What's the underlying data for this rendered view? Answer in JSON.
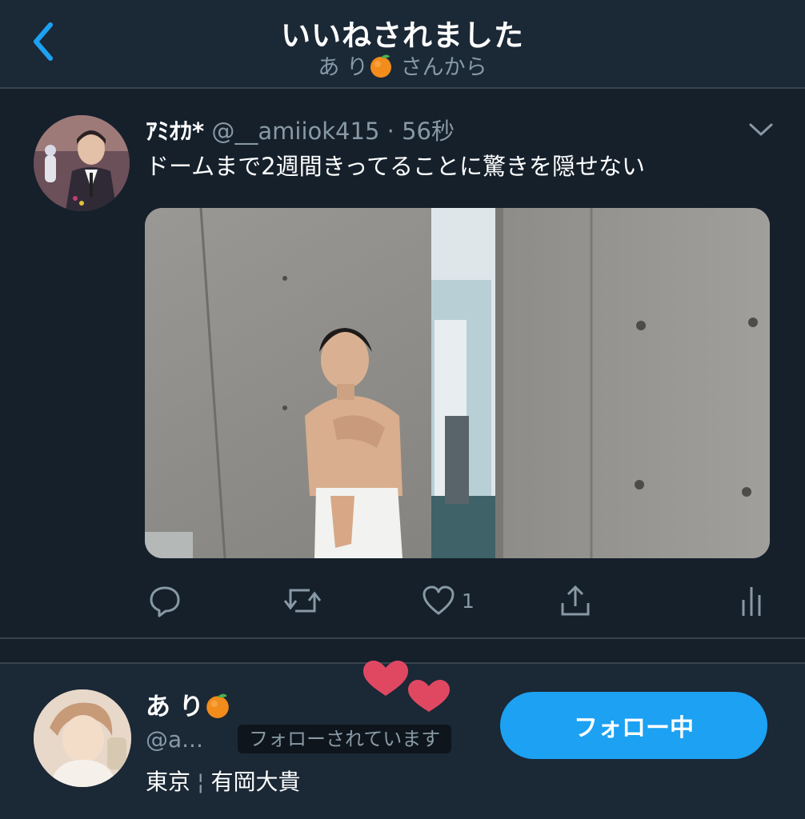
{
  "header": {
    "title": "いいねされました",
    "subtitle_name": "あ り",
    "subtitle_suffix": "さんから"
  },
  "tweet": {
    "author_name": "ｱﾐｵｶ*",
    "author_handle": "@__amiiok415",
    "separator": "·",
    "time": "56秒",
    "text": "ドームまで2週間きってることに驚きを隠せない",
    "like_count": "1"
  },
  "profile": {
    "name": "あ り",
    "handle": "@a...",
    "follows_you": "フォローされています",
    "location": "東京",
    "bio": "有岡大貴",
    "follow_button": "フォロー中"
  },
  "icons": [
    "back-chevron-icon",
    "orange-emoji-icon",
    "caret-down-icon",
    "reply-icon",
    "retweet-icon",
    "heart-icon",
    "share-icon",
    "analytics-icon",
    "hearts-sticker-icon"
  ],
  "colors": {
    "background": "#15202b",
    "header_bg": "#1b2836",
    "accent": "#1da1f2",
    "secondary_text": "#8899a6",
    "heart_sticker": "#e04862"
  }
}
